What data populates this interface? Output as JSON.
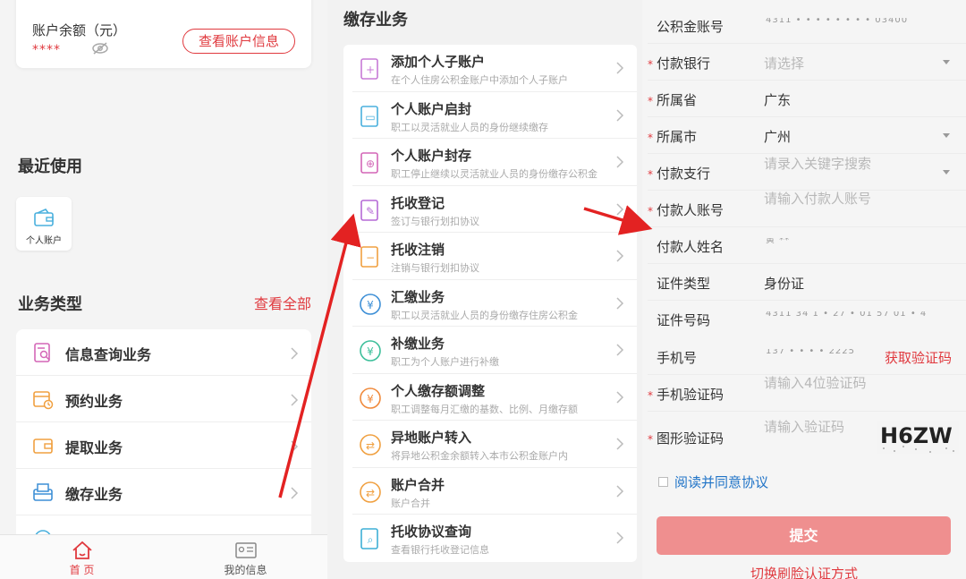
{
  "home": {
    "balance_label": "账户余额（元）",
    "balance_masked": "****",
    "view_account_btn": "查看账户信息",
    "recent_title": "最近使用",
    "recent_items": [
      {
        "label": "个人账户",
        "icon": "wallet-icon"
      }
    ],
    "biz_types_title": "业务类型",
    "view_all": "查看全部",
    "biz_items": [
      {
        "label": "信息查询业务",
        "icon": "document-search-icon"
      },
      {
        "label": "预约业务",
        "icon": "calendar-clock-icon"
      },
      {
        "label": "提取业务",
        "icon": "wallet-withdraw-icon"
      },
      {
        "label": "缴存业务",
        "icon": "inbox-deposit-icon"
      }
    ],
    "tabs": [
      {
        "label": "首 页",
        "icon": "home-icon",
        "active": true
      },
      {
        "label": "我的信息",
        "icon": "id-card-icon",
        "active": false
      }
    ],
    "accent": "#e0393e"
  },
  "deposit": {
    "title": "缴存业务",
    "items": [
      {
        "title": "添加个人子账户",
        "sub": "在个人住房公积金账户中添加个人子账户",
        "icon": "add-user-icon",
        "color": "#c77ad6"
      },
      {
        "title": "个人账户启封",
        "sub": "职工以灵活就业人员的身份继续缴存",
        "icon": "folder-open-icon",
        "color": "#4ab0dd"
      },
      {
        "title": "个人账户封存",
        "sub": "职工停止继续以灵活就业人员的身份缴存公积金",
        "icon": "user-lock-icon",
        "color": "#d467b7"
      },
      {
        "title": "托收登记",
        "sub": "签订与银行划扣协议",
        "icon": "edit-document-icon",
        "color": "#b56ad6"
      },
      {
        "title": "托收注销",
        "sub": "注销与银行划扣协议",
        "icon": "cancel-document-icon",
        "color": "#f0a040"
      },
      {
        "title": "汇缴业务",
        "sub": "职工以灵活就业人员的身份缴存住房公积金",
        "icon": "yen-coin-icon",
        "color": "#3d8fd6"
      },
      {
        "title": "补缴业务",
        "sub": "职工为个人账户进行补缴",
        "icon": "yen-plus-icon",
        "color": "#3dbf9a"
      },
      {
        "title": "个人缴存额调整",
        "sub": "职工调整每月汇缴的基数、比例、月缴存额",
        "icon": "yen-adjust-icon",
        "color": "#f08a3c"
      },
      {
        "title": "异地账户转入",
        "sub": "将异地公积金余额转入本市公积金账户内",
        "icon": "transfer-in-icon",
        "color": "#f0a040"
      },
      {
        "title": "账户合并",
        "sub": "账户合并",
        "icon": "merge-icon",
        "color": "#f0a040"
      },
      {
        "title": "托收协议查询",
        "sub": "查看银行托收登记信息",
        "icon": "document-search-icon",
        "color": "#3dafd6"
      }
    ]
  },
  "form": {
    "fields": [
      {
        "label": "公积金账号",
        "required": false,
        "value_blurred": "4311 • • • • • • • • 03400"
      },
      {
        "label": "付款银行",
        "required": true,
        "placeholder": "请选择",
        "dropdown": true
      },
      {
        "label": "所属省",
        "required": true,
        "value": "广东"
      },
      {
        "label": "所属市",
        "required": true,
        "value": "广州",
        "dropdown": true
      },
      {
        "label": "付款支行",
        "required": true,
        "placeholder": "请录入关键字搜索",
        "dropdown": true
      },
      {
        "label": "付款人账号",
        "required": true,
        "placeholder": "请输入付款人账号"
      },
      {
        "label": "付款人姓名",
        "required": false,
        "value_blurred": "黄 **"
      },
      {
        "label": "证件类型",
        "required": false,
        "value": "身份证"
      },
      {
        "label": "证件号码",
        "required": false,
        "value_blurred": "4311 34 1 • 27 • 01 57 01 • 4"
      },
      {
        "label": "手机号",
        "required": false,
        "value_blurred": "137 • • • • 2225"
      },
      {
        "label": "手机验证码",
        "required": true,
        "placeholder": "请输入4位验证码"
      },
      {
        "label": "图形验证码",
        "required": true,
        "placeholder": "请输入验证码"
      }
    ],
    "get_code": "获取验证码",
    "captcha_text": "H6ZW",
    "agree_label": "阅读并同意协议",
    "submit": "提交",
    "switch_auth": "切换刷脸认证方式"
  }
}
